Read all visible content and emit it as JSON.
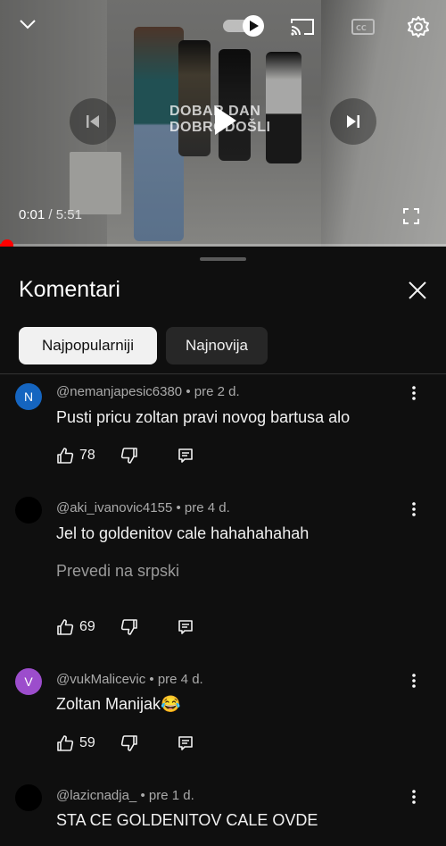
{
  "player": {
    "overlay_text_line1": "DOBAR DAN",
    "overlay_text_line2": "DOBRODOŠLI",
    "current_time": "0:01",
    "separator": " / ",
    "duration": "5:51",
    "progress_fraction": 0.03,
    "autoplay_on": true
  },
  "sheet": {
    "title": "Komentari",
    "chips": [
      {
        "label": "Najpopularniji",
        "active": true
      },
      {
        "label": "Najnovija",
        "active": false
      }
    ]
  },
  "comments": [
    {
      "avatar_letter": "N",
      "avatar_color": "#1565c0",
      "author": "@nemanjapesic6380",
      "time": " • pre 2 d.",
      "text": "Pusti pricu zoltan pravi novog bartusa alo",
      "likes": "78"
    },
    {
      "avatar_letter": "",
      "avatar_color": "#000000",
      "author": "@aki_ivanovic4155",
      "time": " • pre 4 d.",
      "text": "Jel to goldenitov cale hahahahahah",
      "translate": "Prevedi na srpski",
      "likes": "69"
    },
    {
      "avatar_letter": "V",
      "avatar_color": "#9c4dcc",
      "author": "@vukMalicevic",
      "time": " • pre 4 d.",
      "text": "Zoltan Manijak😂",
      "likes": "59"
    },
    {
      "avatar_letter": "",
      "avatar_color": "#000000",
      "author": "@lazicnadja_",
      "time": " • pre 1 d.",
      "text": "STA CE GOLDENITOV CALE OVDE"
    }
  ],
  "colors": {
    "accent": "#ff0000",
    "background": "#0f0f0f",
    "chip_active": "#f1f1f1",
    "chip_inactive": "#272727"
  },
  "icons": [
    "chevron-down-icon",
    "autoplay-toggle-icon",
    "cast-icon",
    "captions-icon",
    "settings-gear-icon",
    "previous-icon",
    "play-icon",
    "next-icon",
    "fullscreen-icon",
    "close-icon",
    "thumb-up-icon",
    "thumb-down-icon",
    "reply-icon",
    "more-vert-icon"
  ]
}
